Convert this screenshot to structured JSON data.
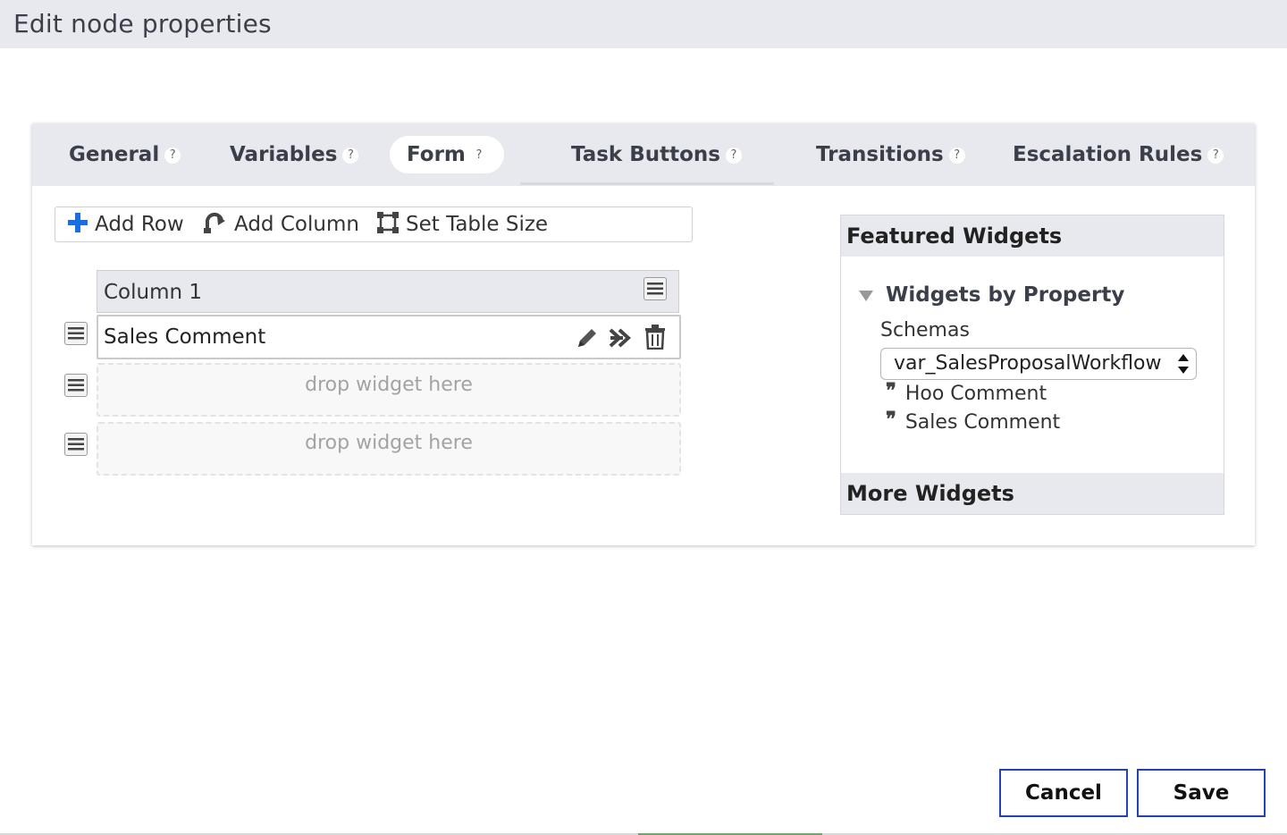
{
  "window": {
    "title": "Edit node properties"
  },
  "tabs": [
    {
      "label": "General",
      "help": "?"
    },
    {
      "label": "Variables",
      "help": "?"
    },
    {
      "label": "Form",
      "help": "?"
    },
    {
      "label": "Task Buttons",
      "help": "?"
    },
    {
      "label": "Transitions",
      "help": "?"
    },
    {
      "label": "Escalation Rules",
      "help": "?"
    }
  ],
  "active_tab": "Form",
  "toolbar": {
    "add_row": "Add Row",
    "add_column": "Add Column",
    "set_table_size": "Set Table Size"
  },
  "form_table": {
    "column_header": "Column 1",
    "rows": [
      {
        "widget": "Sales Comment"
      },
      {
        "placeholder": "drop widget here"
      },
      {
        "placeholder": "drop widget here"
      }
    ]
  },
  "palette": {
    "featured_title": "Featured Widgets",
    "group_title": "Widgets by Property",
    "schemas_label": "Schemas",
    "schema_selected": "var_SalesProposalWorkflow",
    "fields": [
      "Hoo Comment",
      "Sales Comment"
    ],
    "more_title": "More Widgets"
  },
  "buttons": {
    "cancel": "Cancel",
    "save": "Save"
  },
  "colors": {
    "accent": "#2541b2",
    "add_icon": "#1a6fe0",
    "header_bg": "#e8e9ee"
  }
}
